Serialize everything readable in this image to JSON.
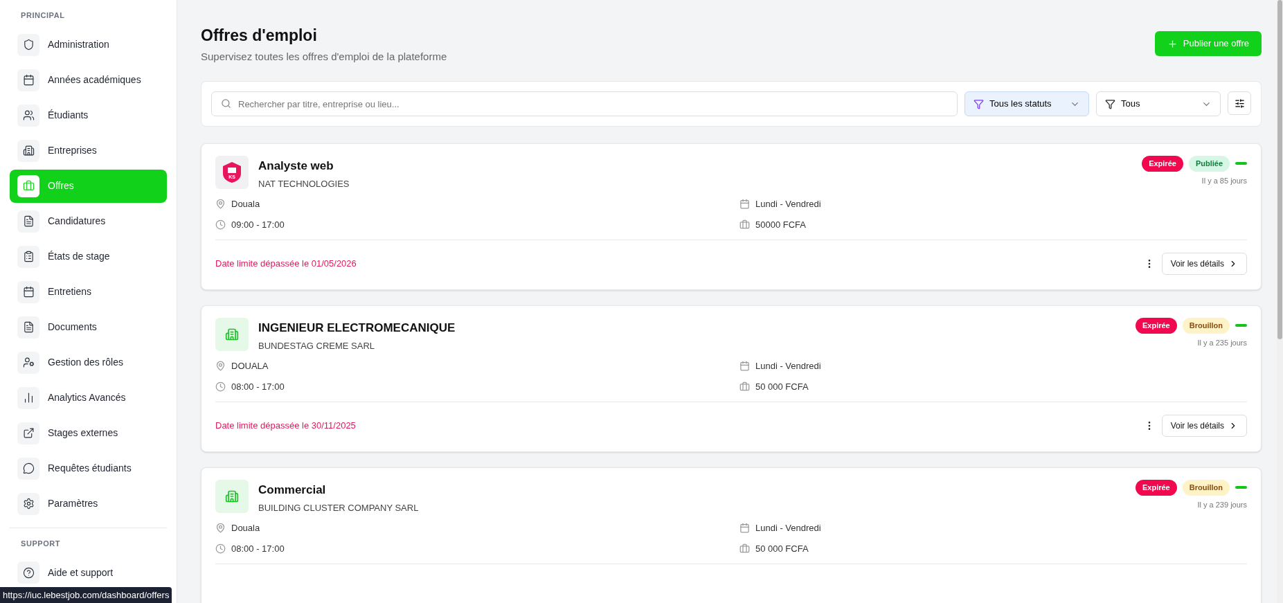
{
  "sidebar": {
    "sections": [
      {
        "title": "PRINCIPAL",
        "items": [
          {
            "label": "Administration",
            "selected": false
          },
          {
            "label": "Années académiques",
            "selected": false
          },
          {
            "label": "Étudiants",
            "selected": false
          },
          {
            "label": "Entreprises",
            "selected": false
          },
          {
            "label": "Offres",
            "selected": true
          },
          {
            "label": "Candidatures",
            "selected": false
          },
          {
            "label": "États de stage",
            "selected": false
          },
          {
            "label": "Entretiens",
            "selected": false
          },
          {
            "label": "Documents",
            "selected": false
          },
          {
            "label": "Gestion des rôles",
            "selected": false
          },
          {
            "label": "Analytics Avancés",
            "selected": false
          },
          {
            "label": "Stages externes",
            "selected": false
          },
          {
            "label": "Requêtes étudiants",
            "selected": false
          },
          {
            "label": "Paramètres",
            "selected": false
          }
        ]
      },
      {
        "title": "SUPPORT",
        "items": [
          {
            "label": "Aide et support",
            "selected": false
          }
        ]
      }
    ]
  },
  "header": {
    "title": "Offres d'emploi",
    "subtitle": "Supervisez toutes les offres d'emploi de la plateforme",
    "button": "Publier une offre"
  },
  "filters": {
    "search": {
      "placeholder": "Rechercher par titre, entreprise ou lieu..."
    },
    "dropdowns": [
      {
        "label": "Tous les statuts",
        "active": true
      },
      {
        "label": "Tous",
        "active": false
      }
    ]
  },
  "offers": [
    {
      "title": "Analyste web",
      "company": "NAT TECHNOLOGIES",
      "logo": {
        "kind": "shield",
        "text": "KS"
      },
      "badges": [
        {
          "label": "Expirée",
          "kind": "expired"
        },
        {
          "label": "Publiée",
          "kind": "published"
        }
      ],
      "age": "Il y a 85 jours",
      "location": "Douala",
      "hours": "09:00 - 17:00",
      "days": "Lundi - Vendredi",
      "salary": "50000 FCFA",
      "deadline": "Date limite dépassée le 01/05/2026",
      "action": "Voir les détails"
    },
    {
      "title": "INGENIEUR ELECTROMECANIQUE",
      "company": "BUNDESTAG CREME SARL",
      "logo": {
        "kind": "building"
      },
      "badges": [
        {
          "label": "Expirée",
          "kind": "expired"
        },
        {
          "label": "Brouillon",
          "kind": "draft"
        }
      ],
      "age": "Il y a 235 jours",
      "location": "DOUALA",
      "hours": "08:00 - 17:00",
      "days": "Lundi - Vendredi",
      "salary": "50 000 FCFA",
      "deadline": "Date limite dépassée le 30/11/2025",
      "action": "Voir les détails"
    },
    {
      "title": "Commercial",
      "company": "BUILDING CLUSTER COMPANY SARL",
      "logo": {
        "kind": "building"
      },
      "badges": [
        {
          "label": "Expirée",
          "kind": "expired"
        },
        {
          "label": "Brouillon",
          "kind": "draft"
        }
      ],
      "age": "Il y a 239 jours",
      "location": "Douala",
      "hours": "08:00 - 17:00",
      "days": "Lundi - Vendredi",
      "salary": "50 000 FCFA"
    }
  ],
  "status_bar": {
    "url": "https://iuc.lebestjob.com/dashboard/offers"
  }
}
